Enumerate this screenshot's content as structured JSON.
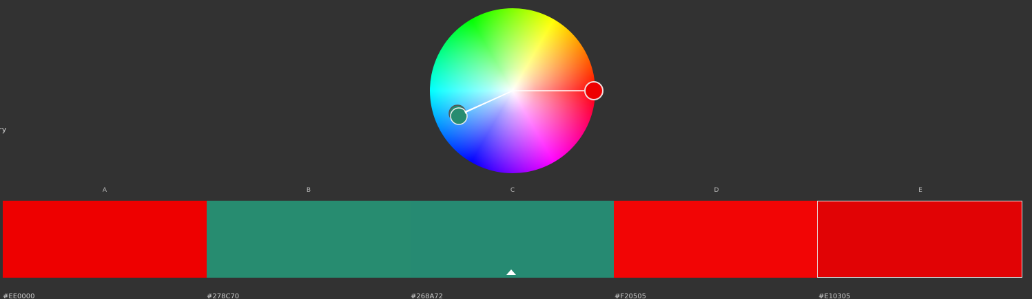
{
  "left_label": "ry",
  "wheel": {
    "base_handle_color": "#EE0000",
    "secondary_handle_color": "#278C70"
  },
  "swatches": [
    {
      "letter": "A",
      "hex": "#EE0000",
      "color": "#EE0000",
      "selected": false
    },
    {
      "letter": "B",
      "hex": "#278C70",
      "color": "#278C70",
      "selected": false
    },
    {
      "letter": "C",
      "hex": "#268A72",
      "color": "#268A72",
      "selected": false,
      "active": true
    },
    {
      "letter": "D",
      "hex": "#F20505",
      "color": "#F20505",
      "selected": false
    },
    {
      "letter": "E",
      "hex": "#E10305",
      "color": "#E10305",
      "selected": true
    }
  ]
}
